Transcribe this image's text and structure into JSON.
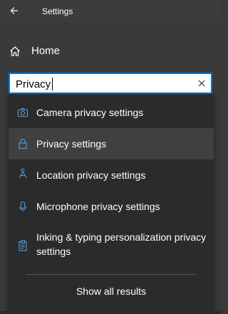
{
  "window": {
    "title": "Settings"
  },
  "nav": {
    "home_label": "Home"
  },
  "search": {
    "value": "Privacy"
  },
  "results": [
    {
      "label": "Camera privacy settings",
      "icon": "camera-icon"
    },
    {
      "label": "Privacy settings",
      "icon": "lock-icon"
    },
    {
      "label": "Location privacy settings",
      "icon": "location-person-icon"
    },
    {
      "label": "Microphone privacy settings",
      "icon": "microphone-icon"
    },
    {
      "label": "Inking & typing personalization privacy settings",
      "icon": "clipboard-icon"
    }
  ],
  "show_all_label": "Show all results",
  "colors": {
    "accent": "#0078d7",
    "icon_blue": "#4f9fe6",
    "background": "#3a3a3a",
    "dropdown": "#2b2b2b",
    "highlight": "#404040"
  }
}
